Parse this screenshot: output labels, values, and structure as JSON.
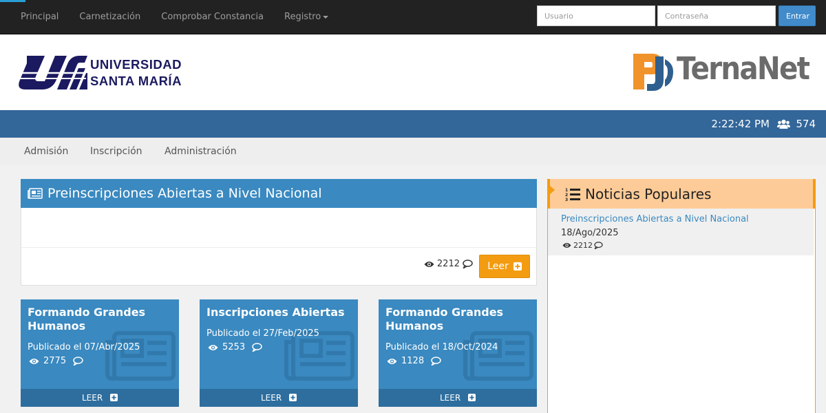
{
  "topnav": {
    "items": [
      "Principal",
      "Carnetización",
      "Comprobar Constancia",
      "Registro"
    ],
    "username_placeholder": "Usuario",
    "password_placeholder": "Contraseña",
    "login_label": "Entrar"
  },
  "header": {
    "university_line1": "UNIVERSIDAD",
    "university_line2": "SANTA MARÍA",
    "brand": "TernaNet"
  },
  "status": {
    "time": "2:22:42 PM",
    "users_online": "574"
  },
  "menu": {
    "items": [
      "Admisión",
      "Inscripción",
      "Administración"
    ]
  },
  "featured": {
    "title": "Preinscripciones Abiertas a Nivel Nacional",
    "views": "2212",
    "read_label": "Leer"
  },
  "cards": [
    {
      "title": "Formando Grandes Humanos",
      "date": "Publicado el 07/Abr/2025",
      "views": "2775",
      "read_label": "LEER"
    },
    {
      "title": "Inscripciones Abiertas",
      "date": "Publicado el 27/Feb/2025",
      "views": "5253",
      "read_label": "LEER"
    },
    {
      "title": "Formando Grandes Humanos",
      "date": "Publicado el 18/Oct/2024",
      "views": "1128",
      "read_label": "LEER"
    }
  ],
  "popular": {
    "title": "Noticias Populares",
    "items": [
      {
        "title": "Preinscripciones Abiertas a Nivel Nacional",
        "date": "18/Ago/2025",
        "views": "2212"
      }
    ]
  },
  "colors": {
    "navbar": "#222222",
    "primary_blue": "#3a89c0",
    "status_bar": "#336699",
    "accent_orange": "#f39c12",
    "usm_navy": "#1b1a60"
  }
}
